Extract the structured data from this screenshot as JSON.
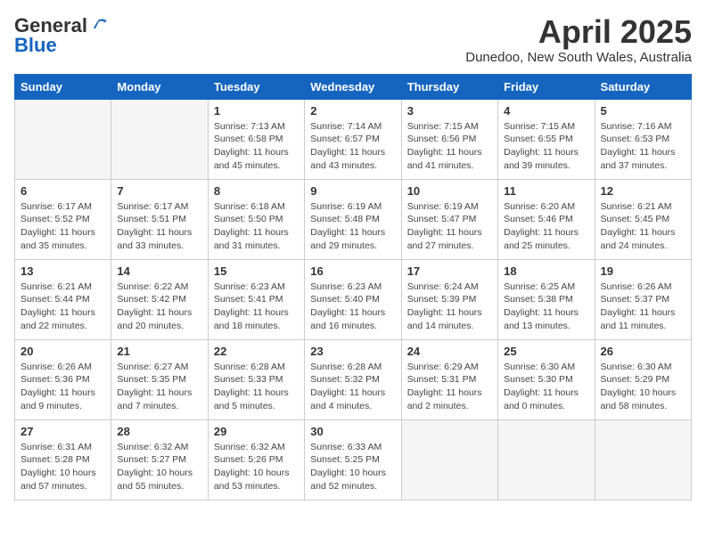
{
  "header": {
    "logo_general": "General",
    "logo_blue": "Blue",
    "month": "April 2025",
    "location": "Dunedoo, New South Wales, Australia"
  },
  "weekdays": [
    "Sunday",
    "Monday",
    "Tuesday",
    "Wednesday",
    "Thursday",
    "Friday",
    "Saturday"
  ],
  "weeks": [
    [
      {
        "day": "",
        "info": ""
      },
      {
        "day": "",
        "info": ""
      },
      {
        "day": "1",
        "info": "Sunrise: 7:13 AM\nSunset: 6:58 PM\nDaylight: 11 hours and 45 minutes."
      },
      {
        "day": "2",
        "info": "Sunrise: 7:14 AM\nSunset: 6:57 PM\nDaylight: 11 hours and 43 minutes."
      },
      {
        "day": "3",
        "info": "Sunrise: 7:15 AM\nSunset: 6:56 PM\nDaylight: 11 hours and 41 minutes."
      },
      {
        "day": "4",
        "info": "Sunrise: 7:15 AM\nSunset: 6:55 PM\nDaylight: 11 hours and 39 minutes."
      },
      {
        "day": "5",
        "info": "Sunrise: 7:16 AM\nSunset: 6:53 PM\nDaylight: 11 hours and 37 minutes."
      }
    ],
    [
      {
        "day": "6",
        "info": "Sunrise: 6:17 AM\nSunset: 5:52 PM\nDaylight: 11 hours and 35 minutes."
      },
      {
        "day": "7",
        "info": "Sunrise: 6:17 AM\nSunset: 5:51 PM\nDaylight: 11 hours and 33 minutes."
      },
      {
        "day": "8",
        "info": "Sunrise: 6:18 AM\nSunset: 5:50 PM\nDaylight: 11 hours and 31 minutes."
      },
      {
        "day": "9",
        "info": "Sunrise: 6:19 AM\nSunset: 5:48 PM\nDaylight: 11 hours and 29 minutes."
      },
      {
        "day": "10",
        "info": "Sunrise: 6:19 AM\nSunset: 5:47 PM\nDaylight: 11 hours and 27 minutes."
      },
      {
        "day": "11",
        "info": "Sunrise: 6:20 AM\nSunset: 5:46 PM\nDaylight: 11 hours and 25 minutes."
      },
      {
        "day": "12",
        "info": "Sunrise: 6:21 AM\nSunset: 5:45 PM\nDaylight: 11 hours and 24 minutes."
      }
    ],
    [
      {
        "day": "13",
        "info": "Sunrise: 6:21 AM\nSunset: 5:44 PM\nDaylight: 11 hours and 22 minutes."
      },
      {
        "day": "14",
        "info": "Sunrise: 6:22 AM\nSunset: 5:42 PM\nDaylight: 11 hours and 20 minutes."
      },
      {
        "day": "15",
        "info": "Sunrise: 6:23 AM\nSunset: 5:41 PM\nDaylight: 11 hours and 18 minutes."
      },
      {
        "day": "16",
        "info": "Sunrise: 6:23 AM\nSunset: 5:40 PM\nDaylight: 11 hours and 16 minutes."
      },
      {
        "day": "17",
        "info": "Sunrise: 6:24 AM\nSunset: 5:39 PM\nDaylight: 11 hours and 14 minutes."
      },
      {
        "day": "18",
        "info": "Sunrise: 6:25 AM\nSunset: 5:38 PM\nDaylight: 11 hours and 13 minutes."
      },
      {
        "day": "19",
        "info": "Sunrise: 6:26 AM\nSunset: 5:37 PM\nDaylight: 11 hours and 11 minutes."
      }
    ],
    [
      {
        "day": "20",
        "info": "Sunrise: 6:26 AM\nSunset: 5:36 PM\nDaylight: 11 hours and 9 minutes."
      },
      {
        "day": "21",
        "info": "Sunrise: 6:27 AM\nSunset: 5:35 PM\nDaylight: 11 hours and 7 minutes."
      },
      {
        "day": "22",
        "info": "Sunrise: 6:28 AM\nSunset: 5:33 PM\nDaylight: 11 hours and 5 minutes."
      },
      {
        "day": "23",
        "info": "Sunrise: 6:28 AM\nSunset: 5:32 PM\nDaylight: 11 hours and 4 minutes."
      },
      {
        "day": "24",
        "info": "Sunrise: 6:29 AM\nSunset: 5:31 PM\nDaylight: 11 hours and 2 minutes."
      },
      {
        "day": "25",
        "info": "Sunrise: 6:30 AM\nSunset: 5:30 PM\nDaylight: 11 hours and 0 minutes."
      },
      {
        "day": "26",
        "info": "Sunrise: 6:30 AM\nSunset: 5:29 PM\nDaylight: 10 hours and 58 minutes."
      }
    ],
    [
      {
        "day": "27",
        "info": "Sunrise: 6:31 AM\nSunset: 5:28 PM\nDaylight: 10 hours and 57 minutes."
      },
      {
        "day": "28",
        "info": "Sunrise: 6:32 AM\nSunset: 5:27 PM\nDaylight: 10 hours and 55 minutes."
      },
      {
        "day": "29",
        "info": "Sunrise: 6:32 AM\nSunset: 5:26 PM\nDaylight: 10 hours and 53 minutes."
      },
      {
        "day": "30",
        "info": "Sunrise: 6:33 AM\nSunset: 5:25 PM\nDaylight: 10 hours and 52 minutes."
      },
      {
        "day": "",
        "info": ""
      },
      {
        "day": "",
        "info": ""
      },
      {
        "day": "",
        "info": ""
      }
    ]
  ]
}
